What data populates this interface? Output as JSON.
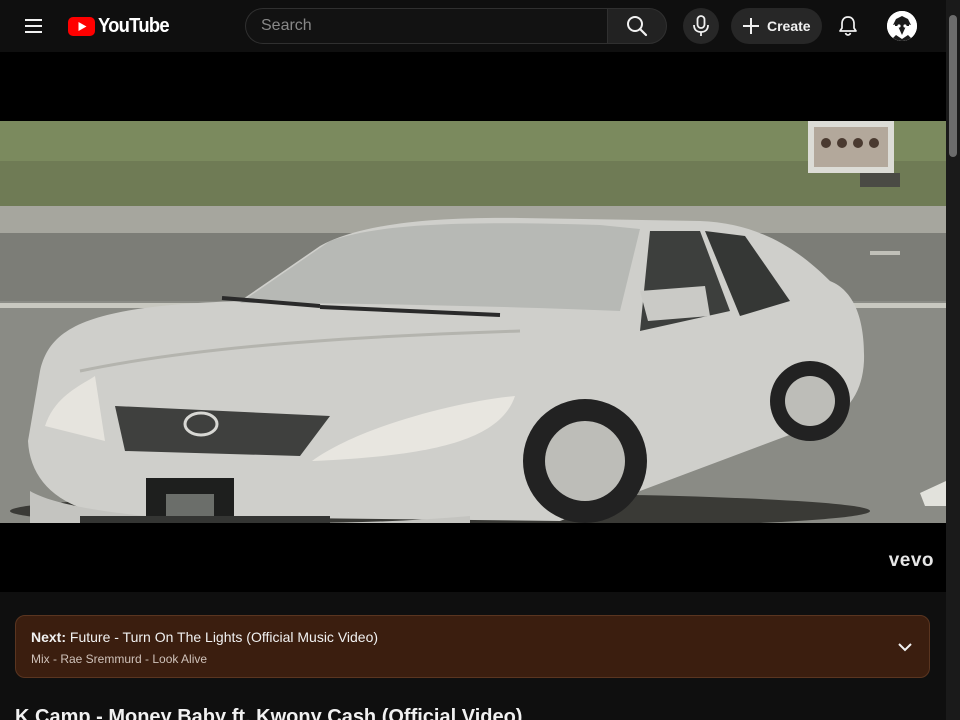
{
  "header": {
    "logo_text": "YouTube",
    "search_placeholder": "Search",
    "create_label": "Create",
    "icons": [
      "menu-icon",
      "youtube-logo",
      "search-icon",
      "mic-icon",
      "plus-icon",
      "bell-icon",
      "avatar"
    ]
  },
  "player": {
    "watermark": "vevo"
  },
  "next_card": {
    "prefix": "Next:",
    "title": "Future - Turn On The Lights (Official Music Video)",
    "mix_line": "Mix - Rae Sremmurd - Look Alive"
  },
  "video": {
    "title": "K Camp - Money Baby ft. Kwony Cash (Official Video)"
  },
  "colors": {
    "background": "#0f0f0f",
    "brand_red": "#ff0000",
    "next_card_bg": "#3b1e0f"
  }
}
